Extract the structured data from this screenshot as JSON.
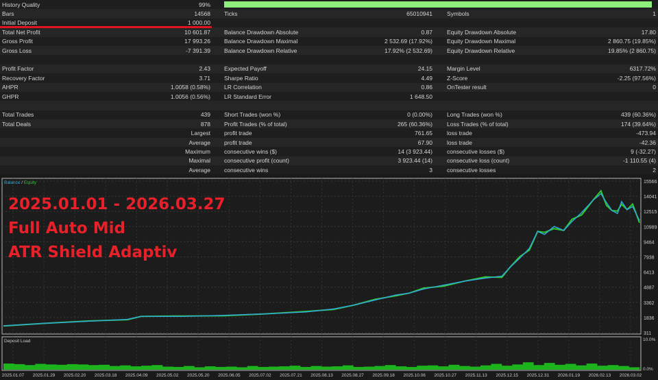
{
  "stats": {
    "history_quality": {
      "label": "History Quality",
      "value": "99%",
      "fill": 0.99
    },
    "rows": [
      [
        "Bars",
        "14568",
        "Ticks",
        "65010941",
        "Symbols",
        "1"
      ],
      [
        "Initial Deposit",
        "1 000.00",
        "",
        "",
        "",
        ""
      ],
      [
        "Total Net Profit",
        "10 601.87",
        "Balance Drawdown Absolute",
        "0.87",
        "Equity Drawdown Absolute",
        "17.80"
      ],
      [
        "Gross Profit",
        "17 993.26",
        "Balance Drawdown Maximal",
        "2 532.69 (17.92%)",
        "Equity Drawdown Maximal",
        "2 860.75 (19.85%)"
      ],
      [
        "Gross Loss",
        "-7 391.39",
        "Balance Drawdown Relative",
        "17.92% (2 532.69)",
        "Equity Drawdown Relative",
        "19.85% (2 860.75)"
      ],
      [
        "",
        "",
        "",
        "",
        "",
        ""
      ],
      [
        "Profit Factor",
        "2.43",
        "Expected Payoff",
        "24.15",
        "Margin Level",
        "6317.72%"
      ],
      [
        "Recovery Factor",
        "3.71",
        "Sharpe Ratio",
        "4.49",
        "Z-Score",
        "-2.25 (97.56%)"
      ],
      [
        "AHPR",
        "1.0058 (0.58%)",
        "LR Correlation",
        "0.86",
        "OnTester result",
        "0"
      ],
      [
        "GHPR",
        "1.0056 (0.56%)",
        "LR Standard Error",
        "1 648.50",
        "",
        ""
      ],
      [
        "",
        "",
        "",
        "",
        "",
        ""
      ],
      [
        "Total Trades",
        "439",
        "Short Trades (won %)",
        "0 (0.00%)",
        "Long Trades (won %)",
        "439 (60.36%)"
      ],
      [
        "Total Deals",
        "878",
        "Profit Trades (% of total)",
        "265 (60.36%)",
        "Loss Trades (% of total)",
        "174 (39.64%)"
      ],
      [
        "",
        "Largest",
        "profit trade",
        "761.65",
        "loss trade",
        "-473.94"
      ],
      [
        "",
        "Average",
        "profit trade",
        "67.90",
        "loss trade",
        "-42.36"
      ],
      [
        "",
        "Maximum",
        "consecutive wins ($)",
        "14 (3 923.44)",
        "consecutive losses ($)",
        "9 (-32.27)"
      ],
      [
        "",
        "Maximal",
        "consecutive profit (count)",
        "3 923.44 (14)",
        "consecutive loss (count)",
        "-1 110.55 (4)"
      ],
      [
        "",
        "Average",
        "consecutive wins",
        "3",
        "consecutive losses",
        "2"
      ]
    ]
  },
  "overlay": [
    "2025.01.01 - 2026.03.27",
    "Full Auto Mid",
    "ATR Shield Adaptiv"
  ],
  "chart_data": {
    "type": "line",
    "legend": [
      "Balance",
      "Equity"
    ],
    "legend_sep": " / ",
    "colors": {
      "balance": "#2fa8d8",
      "equity": "#2ec92e",
      "load": "#1db31d"
    },
    "yticks": [
      "15566",
      "14041",
      "12515",
      "10989",
      "9464",
      "7938",
      "6413",
      "4887",
      "3362",
      "1836",
      "311"
    ],
    "ylim": [
      311,
      15566
    ],
    "xlim": [
      0,
      462
    ],
    "balance": [
      [
        0,
        1000
      ],
      [
        30,
        1250
      ],
      [
        60,
        1450
      ],
      [
        90,
        1650
      ],
      [
        100,
        1950
      ],
      [
        130,
        1950
      ],
      [
        160,
        2050
      ],
      [
        190,
        2200
      ],
      [
        220,
        2400
      ],
      [
        240,
        2700
      ],
      [
        255,
        3100
      ],
      [
        270,
        3600
      ],
      [
        285,
        4100
      ],
      [
        295,
        4300
      ],
      [
        305,
        4700
      ],
      [
        320,
        5100
      ],
      [
        335,
        5500
      ],
      [
        350,
        5800
      ],
      [
        362,
        6000
      ],
      [
        368,
        6900
      ],
      [
        375,
        7800
      ],
      [
        382,
        8800
      ],
      [
        388,
        10500
      ],
      [
        393,
        10200
      ],
      [
        400,
        11000
      ],
      [
        407,
        10600
      ],
      [
        413,
        11500
      ],
      [
        420,
        12400
      ],
      [
        428,
        13600
      ],
      [
        434,
        14300
      ],
      [
        438,
        13400
      ],
      [
        442,
        12600
      ],
      [
        446,
        12300
      ],
      [
        449,
        13500
      ],
      [
        453,
        12700
      ],
      [
        457,
        13000
      ],
      [
        462,
        11600
      ]
    ],
    "load_title": "Deposit Load",
    "load_ticks": [
      "10.0%",
      "0.0%"
    ],
    "load": [
      2,
      1.8,
      1.5,
      1.9,
      1.7,
      1.6,
      1.8,
      1.7,
      1.5,
      1.6,
      1.2,
      1.4,
      1.1,
      1.3,
      1.5,
      1.0,
      0.9,
      1.2,
      0.8,
      1.1,
      0.9,
      1.0,
      0.8,
      1.2,
      0.9,
      1.0,
      1.1,
      1.3,
      0.9,
      1.2,
      1.0,
      1.1,
      1.4,
      0.9,
      1.0,
      1.2,
      1.5,
      1.1,
      0.9,
      1.3,
      1.4,
      1.1,
      1.6,
      1.2,
      1.0,
      1.4,
      1.9,
      1.3,
      1.7,
      2.4,
      1.5,
      2.2,
      1.6,
      1.9,
      1.4,
      2.0,
      1.3,
      1.5,
      1.2,
      0.8
    ],
    "xticks": [
      "2025.01.07",
      "2025.01.29",
      "2025.02.20",
      "2025.03.18",
      "2025.04.09",
      "2025.05.02",
      "2025.05.20",
      "2025.06.05",
      "2025.07.02",
      "2025.07.21",
      "2025.08.13",
      "2025.08.27",
      "2025.09.18",
      "2025.10.06",
      "2025.10.27",
      "2025.11.13",
      "2025.12.15",
      "2025.12.31",
      "2026.01.19",
      "2026.02.13",
      "2026.03.02"
    ]
  }
}
